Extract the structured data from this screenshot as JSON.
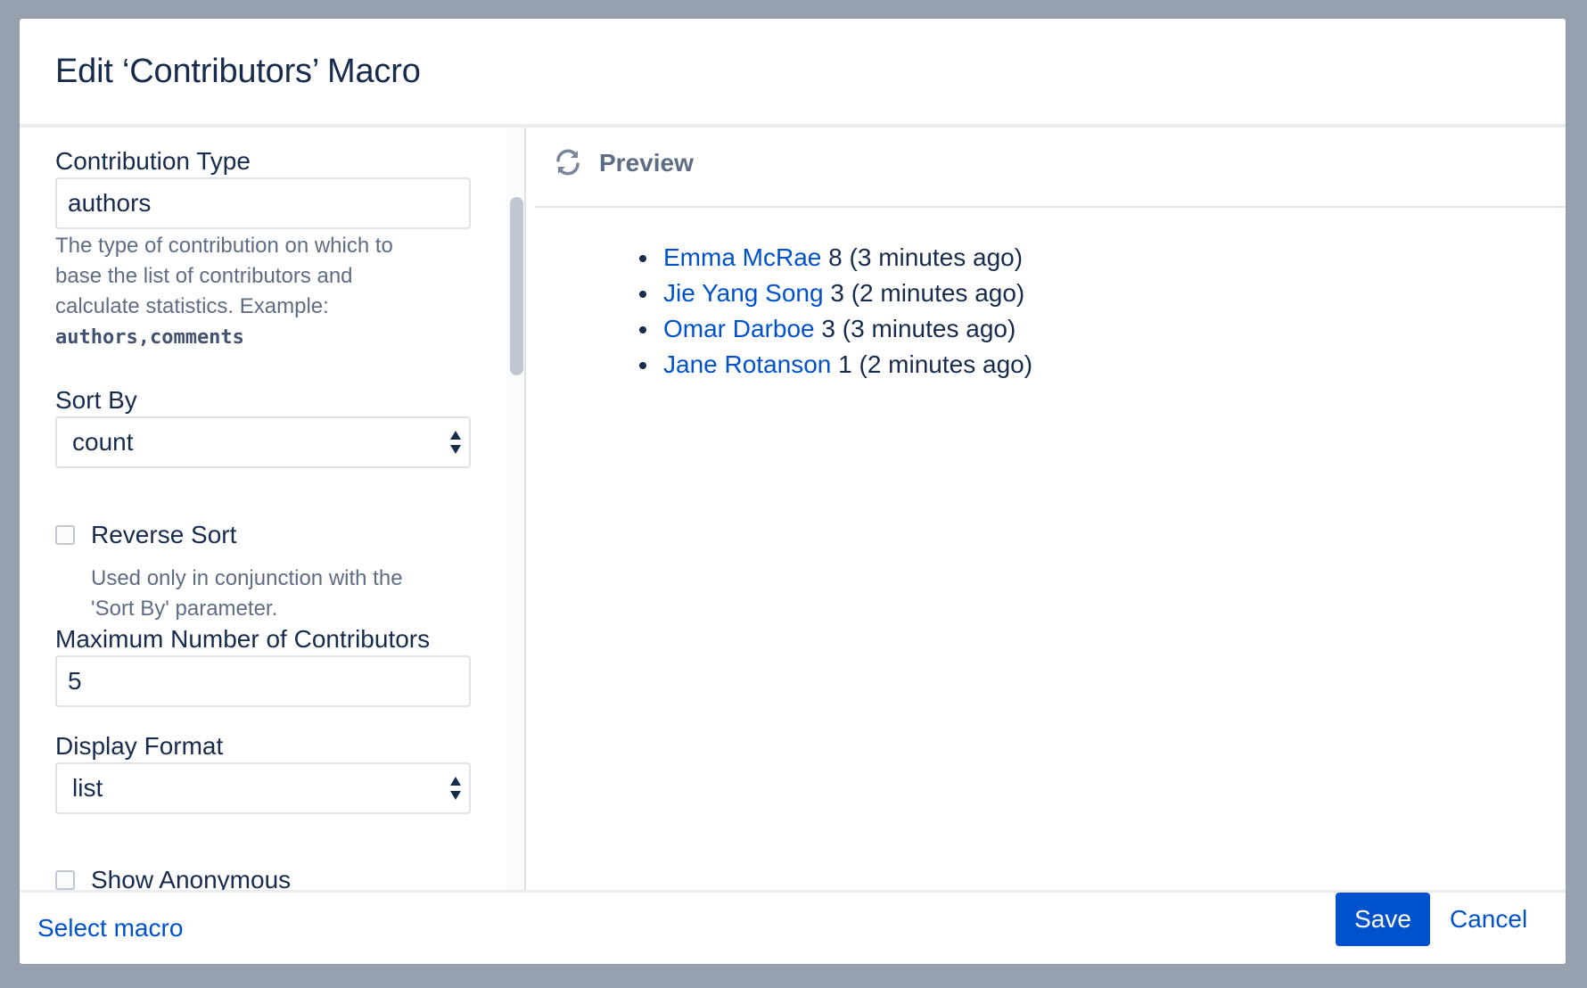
{
  "dialog": {
    "title": "Edit ‘Contributors’ Macro"
  },
  "form": {
    "contribution_type": {
      "label": "Contribution Type",
      "value": "authors",
      "help_text": "The type of contribution on which to base the list of contributors and calculate statistics. Example:",
      "help_example": "authors,comments"
    },
    "sort_by": {
      "label": "Sort By",
      "value": "count"
    },
    "reverse_sort": {
      "label": "Reverse Sort",
      "checked": false,
      "help_text": "Used only in conjunction with the 'Sort By' parameter."
    },
    "max_contributors": {
      "label": "Maximum Number of Contributors",
      "value": "5"
    },
    "display_format": {
      "label": "Display Format",
      "value": "list"
    },
    "show_anonymous": {
      "label": "Show Anonymous",
      "checked": false
    }
  },
  "preview": {
    "title": "Preview",
    "contributors": [
      {
        "name": "Emma McRae",
        "count": "8",
        "time": "(3 minutes ago)"
      },
      {
        "name": "Jie Yang Song",
        "count": "3",
        "time": "(2 minutes ago)"
      },
      {
        "name": "Omar Darboe",
        "count": "3",
        "time": "(3 minutes ago)"
      },
      {
        "name": "Jane Rotanson",
        "count": "1",
        "time": "(2 minutes ago)"
      }
    ]
  },
  "footer": {
    "select_macro": "Select macro",
    "save": "Save",
    "cancel": "Cancel"
  },
  "icons": {
    "refresh": "refresh-icon",
    "select_arrows": "select-arrows-icon"
  },
  "colors": {
    "primary": "#0052cc",
    "text": "#172b4d",
    "subtle_text": "#5e6c84",
    "backdrop": "#97a0af"
  }
}
